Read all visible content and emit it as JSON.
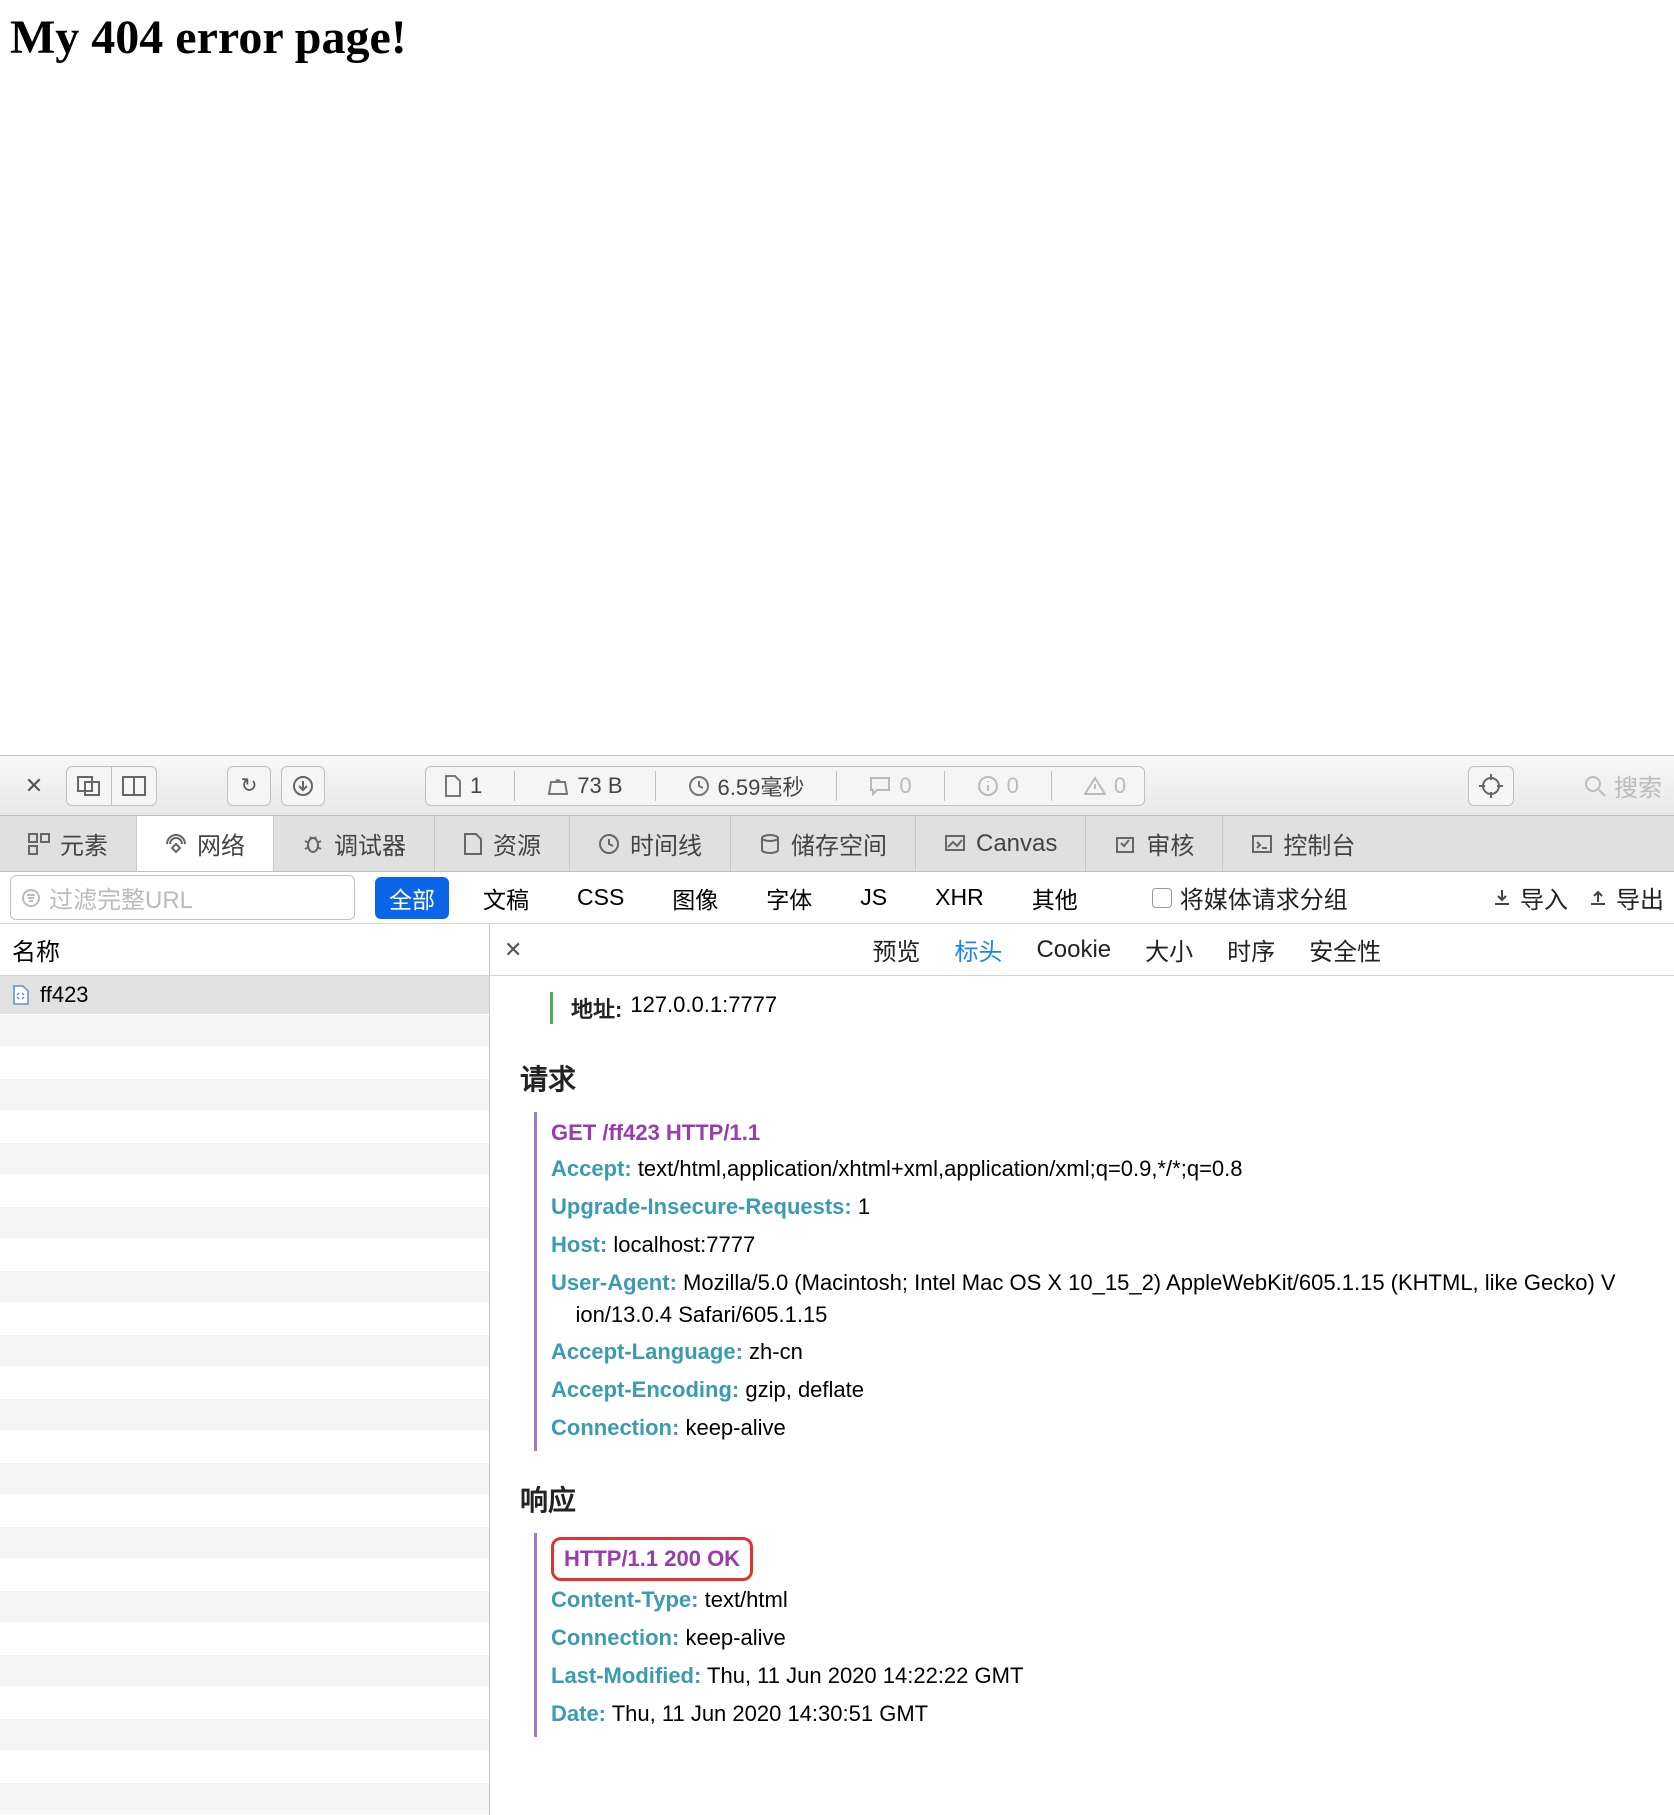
{
  "page": {
    "heading": "My 404 error page!"
  },
  "toolbar": {
    "page_count": "1",
    "size": "73 B",
    "time": "6.59毫秒",
    "msg_count": "0",
    "warn_count": "0",
    "err_count": "0",
    "search_placeholder": "搜索"
  },
  "main_tabs": [
    {
      "icon": "elements-icon",
      "label": "元素"
    },
    {
      "icon": "network-icon",
      "label": "网络"
    },
    {
      "icon": "debugger-icon",
      "label": "调试器"
    },
    {
      "icon": "resources-icon",
      "label": "资源"
    },
    {
      "icon": "timeline-icon",
      "label": "时间线"
    },
    {
      "icon": "storage-icon",
      "label": "储存空间"
    },
    {
      "icon": "canvas-icon",
      "label": "Canvas"
    },
    {
      "icon": "audit-icon",
      "label": "审核"
    },
    {
      "icon": "console-icon",
      "label": "控制台"
    }
  ],
  "filter": {
    "placeholder": "过滤完整URL",
    "types": [
      "全部",
      "文稿",
      "CSS",
      "图像",
      "字体",
      "JS",
      "XHR",
      "其他"
    ],
    "group_media_label": "将媒体请求分组",
    "import_label": "导入",
    "export_label": "导出"
  },
  "list": {
    "column_header": "名称",
    "rows": [
      "ff423"
    ]
  },
  "detail": {
    "subtabs": [
      "预览",
      "标头",
      "Cookie",
      "大小",
      "时序",
      "安全性"
    ],
    "address": {
      "label": "地址:",
      "value": "127.0.0.1:7777"
    },
    "request_title": "请求",
    "request_first_line": "GET /ff423 HTTP/1.1",
    "request_headers": [
      {
        "k": "Accept:",
        "v": "text/html,application/xhtml+xml,application/xml;q=0.9,*/*;q=0.8"
      },
      {
        "k": "Upgrade-Insecure-Requests:",
        "v": "1"
      },
      {
        "k": "Host:",
        "v": "localhost:7777"
      },
      {
        "k": "User-Agent:",
        "v": "Mozilla/5.0 (Macintosh; Intel Mac OS X 10_15_2) AppleWebKit/605.1.15 (KHTML, like Gecko) Version/13.0.4 Safari/605.1.15"
      },
      {
        "k": "Accept-Language:",
        "v": "zh-cn"
      },
      {
        "k": "Accept-Encoding:",
        "v": "gzip, deflate"
      },
      {
        "k": "Connection:",
        "v": "keep-alive"
      }
    ],
    "response_title": "响应",
    "response_first_line": "HTTP/1.1 200 OK",
    "response_headers": [
      {
        "k": "Content-Type:",
        "v": "text/html"
      },
      {
        "k": "Connection:",
        "v": "keep-alive"
      },
      {
        "k": "Last-Modified:",
        "v": "Thu, 11 Jun 2020 14:22:22 GMT"
      },
      {
        "k": "Date:",
        "v": "Thu, 11 Jun 2020 14:30:51 GMT"
      }
    ]
  }
}
